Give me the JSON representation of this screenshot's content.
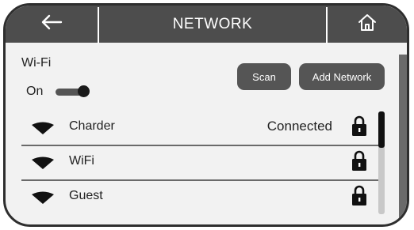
{
  "header": {
    "title": "NETWORK",
    "back_icon": "arrow-left-icon",
    "home_icon": "home-icon"
  },
  "wifi": {
    "label": "Wi-Fi",
    "toggle_label": "On",
    "enabled": true
  },
  "buttons": {
    "scan": "Scan",
    "add_network": "Add Network"
  },
  "networks": [
    {
      "ssid": "Charder",
      "status": "Connected",
      "locked": true,
      "icon": "wifi-signal-icon"
    },
    {
      "ssid": "WiFi",
      "status": "",
      "locked": true,
      "icon": "wifi-signal-icon"
    },
    {
      "ssid": "Guest",
      "status": "",
      "locked": true,
      "icon": "wifi-signal-icon"
    }
  ],
  "colors": {
    "header_bg": "#4d4d4d",
    "button_bg": "#555555",
    "screen_bg": "#f2f2f2"
  }
}
